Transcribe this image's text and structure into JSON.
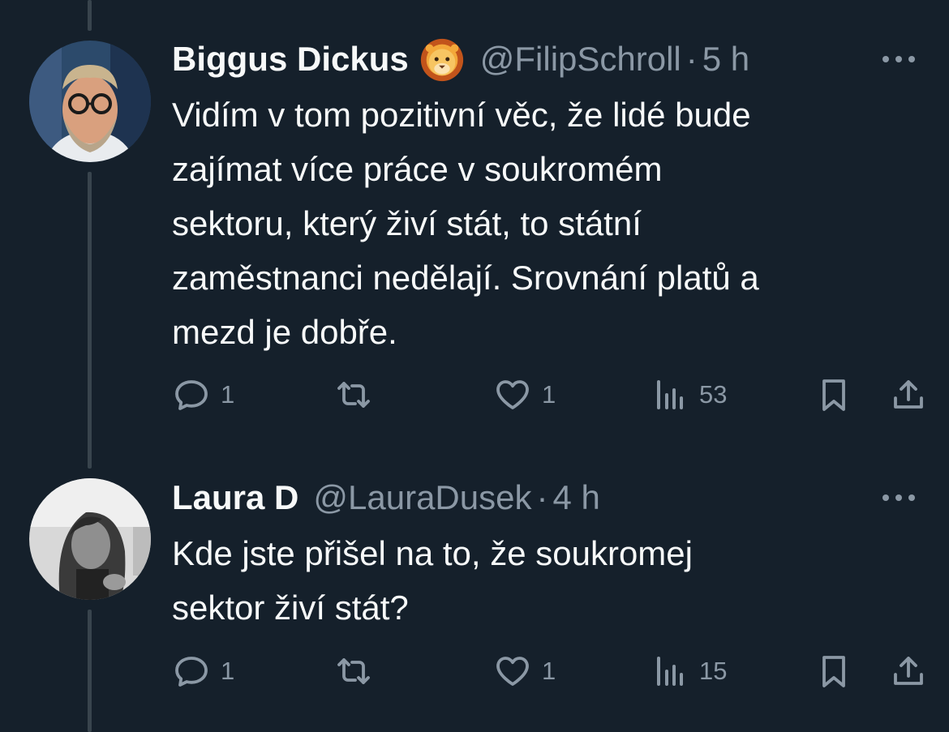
{
  "tweets": [
    {
      "name": "Biggus Dickus",
      "emoji": "lion-face-icon",
      "handle": "@FilipSchroll",
      "separator": "·",
      "time": "5 h",
      "text": "Vidím v tom pozitivní věc, že lidé bude\nzajímat více práce v soukromém\nsektoru, který živí stát, to státní\nzaměstnanci nedělají. Srovnání platů a\nmezd je dobře.",
      "replies": "1",
      "retweets": "",
      "likes": "1",
      "views": "53"
    },
    {
      "name": "Laura D",
      "handle": "@LauraDusek",
      "separator": "·",
      "time": "4 h",
      "text": "Kde jste přišel na to, že soukromej\nsektor živí stát?",
      "replies": "1",
      "retweets": "",
      "likes": "1",
      "views": "15"
    }
  ],
  "colors": {
    "background": "#15202b",
    "text": "#f7f9f9",
    "secondary": "#8b98a5",
    "thread_line": "#38444d"
  }
}
